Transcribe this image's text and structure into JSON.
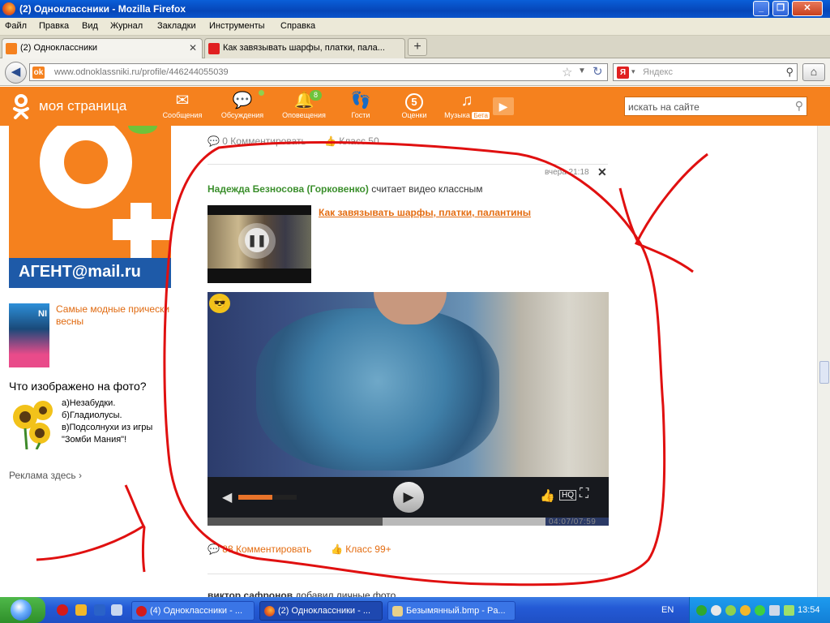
{
  "window": {
    "title": "(2) Одноклассники - Mozilla Firefox",
    "controls": [
      "minimize-icon",
      "restore-icon",
      "close-icon"
    ]
  },
  "menubar": [
    "Файл",
    "Правка",
    "Вид",
    "Журнал",
    "Закладки",
    "Инструменты",
    "Справка"
  ],
  "tabs": [
    {
      "label": "(2) Одноклассники",
      "active": true,
      "icon": "ok-favicon"
    },
    {
      "label": "Как завязывать шарфы, платки, пала...",
      "active": false,
      "icon": "youtube-favicon"
    }
  ],
  "navbar": {
    "url": "www.odnoklassniki.ru/profile/446244055039",
    "search_placeholder": "Яндекс",
    "search_engine_badge": "Я"
  },
  "ok_header": {
    "title": "моя страница",
    "nav": [
      {
        "label": "Сообщения",
        "icon": "envelope-icon"
      },
      {
        "label": "Обсуждения",
        "icon": "chat-bubbles-icon"
      },
      {
        "label": "Оповещения",
        "icon": "bell-icon",
        "badge": "8"
      },
      {
        "label": "Гости",
        "icon": "footprints-icon"
      },
      {
        "label": "Оценки",
        "icon": "rating-five-icon",
        "value": "5"
      },
      {
        "label": "Музыка",
        "icon": "music-note-icon",
        "tag": "Бета"
      }
    ],
    "search_placeholder": "искать на сайте"
  },
  "left_column": {
    "banner_text": "АГЕНТ@mail.ru",
    "promo_text": "Самые модные прически весны",
    "promo_overlay_text": "NI",
    "quiz_title": "Что изображено на фото?",
    "quiz_options": [
      "а)Незабудки.",
      "б)Гладиолусы.",
      "в)Подсолнухи из игры",
      "\"Зомби Мания\"!"
    ],
    "ad_link": "Реклама здесь ›"
  },
  "feed": {
    "prev_comments": "0 Комментировать",
    "prev_class": "Класс 50",
    "time": "вчера 21:18",
    "author": "Надежда Безносова (Горковенко)",
    "action": " считает видео классным",
    "video_title": "Как завязывать шарфы, платки, палантины",
    "player": {
      "timecode": "04:07/07:59",
      "hq_label": "HQ",
      "played_fraction": 0.518,
      "volume_fraction": 0.58
    },
    "comments": "88 Комментировать",
    "class_count": "Класс 99+",
    "next_author": "виктор сафронов",
    "next_action": " добавил личные фото"
  },
  "taskbar": {
    "tasks": [
      {
        "label": "(4) Одноклассники - ...",
        "icon": "opera-icon"
      },
      {
        "label": "(2) Одноклассники - ...",
        "icon": "firefox-icon"
      },
      {
        "label": "Безымянный.bmp - Pa...",
        "icon": "paint-icon"
      }
    ],
    "language": "EN",
    "clock": "13:54"
  },
  "colors": {
    "ok_orange": "#f5811e",
    "annotation_red": "#e01010",
    "xp_blue": "#245ad6",
    "author_green": "#3b8f2c",
    "link_orange": "#e46d12"
  }
}
